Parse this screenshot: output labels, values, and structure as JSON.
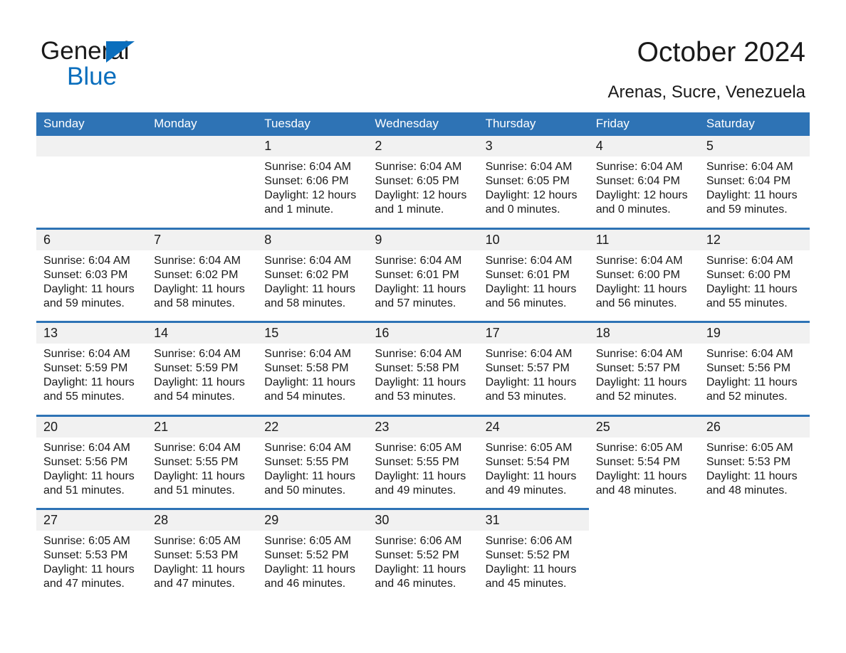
{
  "brand": {
    "name_part1": "General",
    "name_part2": "Blue",
    "accent_color": "#0a6ebd"
  },
  "header": {
    "title": "October 2024",
    "location": "Arenas, Sucre, Venezuela"
  },
  "theme": {
    "header_blue": "#2e73b5",
    "daynum_band": "#f1f1f1",
    "text": "#1a1a1a"
  },
  "calendar": {
    "weekday_headers": [
      "Sunday",
      "Monday",
      "Tuesday",
      "Wednesday",
      "Thursday",
      "Friday",
      "Saturday"
    ],
    "weeks": [
      [
        {
          "day": "",
          "lines": []
        },
        {
          "day": "",
          "lines": []
        },
        {
          "day": "1",
          "lines": [
            "Sunrise: 6:04 AM",
            "Sunset: 6:06 PM",
            "Daylight: 12 hours",
            "and 1 minute."
          ]
        },
        {
          "day": "2",
          "lines": [
            "Sunrise: 6:04 AM",
            "Sunset: 6:05 PM",
            "Daylight: 12 hours",
            "and 1 minute."
          ]
        },
        {
          "day": "3",
          "lines": [
            "Sunrise: 6:04 AM",
            "Sunset: 6:05 PM",
            "Daylight: 12 hours",
            "and 0 minutes."
          ]
        },
        {
          "day": "4",
          "lines": [
            "Sunrise: 6:04 AM",
            "Sunset: 6:04 PM",
            "Daylight: 12 hours",
            "and 0 minutes."
          ]
        },
        {
          "day": "5",
          "lines": [
            "Sunrise: 6:04 AM",
            "Sunset: 6:04 PM",
            "Daylight: 11 hours",
            "and 59 minutes."
          ]
        }
      ],
      [
        {
          "day": "6",
          "lines": [
            "Sunrise: 6:04 AM",
            "Sunset: 6:03 PM",
            "Daylight: 11 hours",
            "and 59 minutes."
          ]
        },
        {
          "day": "7",
          "lines": [
            "Sunrise: 6:04 AM",
            "Sunset: 6:02 PM",
            "Daylight: 11 hours",
            "and 58 minutes."
          ]
        },
        {
          "day": "8",
          "lines": [
            "Sunrise: 6:04 AM",
            "Sunset: 6:02 PM",
            "Daylight: 11 hours",
            "and 58 minutes."
          ]
        },
        {
          "day": "9",
          "lines": [
            "Sunrise: 6:04 AM",
            "Sunset: 6:01 PM",
            "Daylight: 11 hours",
            "and 57 minutes."
          ]
        },
        {
          "day": "10",
          "lines": [
            "Sunrise: 6:04 AM",
            "Sunset: 6:01 PM",
            "Daylight: 11 hours",
            "and 56 minutes."
          ]
        },
        {
          "day": "11",
          "lines": [
            "Sunrise: 6:04 AM",
            "Sunset: 6:00 PM",
            "Daylight: 11 hours",
            "and 56 minutes."
          ]
        },
        {
          "day": "12",
          "lines": [
            "Sunrise: 6:04 AM",
            "Sunset: 6:00 PM",
            "Daylight: 11 hours",
            "and 55 minutes."
          ]
        }
      ],
      [
        {
          "day": "13",
          "lines": [
            "Sunrise: 6:04 AM",
            "Sunset: 5:59 PM",
            "Daylight: 11 hours",
            "and 55 minutes."
          ]
        },
        {
          "day": "14",
          "lines": [
            "Sunrise: 6:04 AM",
            "Sunset: 5:59 PM",
            "Daylight: 11 hours",
            "and 54 minutes."
          ]
        },
        {
          "day": "15",
          "lines": [
            "Sunrise: 6:04 AM",
            "Sunset: 5:58 PM",
            "Daylight: 11 hours",
            "and 54 minutes."
          ]
        },
        {
          "day": "16",
          "lines": [
            "Sunrise: 6:04 AM",
            "Sunset: 5:58 PM",
            "Daylight: 11 hours",
            "and 53 minutes."
          ]
        },
        {
          "day": "17",
          "lines": [
            "Sunrise: 6:04 AM",
            "Sunset: 5:57 PM",
            "Daylight: 11 hours",
            "and 53 minutes."
          ]
        },
        {
          "day": "18",
          "lines": [
            "Sunrise: 6:04 AM",
            "Sunset: 5:57 PM",
            "Daylight: 11 hours",
            "and 52 minutes."
          ]
        },
        {
          "day": "19",
          "lines": [
            "Sunrise: 6:04 AM",
            "Sunset: 5:56 PM",
            "Daylight: 11 hours",
            "and 52 minutes."
          ]
        }
      ],
      [
        {
          "day": "20",
          "lines": [
            "Sunrise: 6:04 AM",
            "Sunset: 5:56 PM",
            "Daylight: 11 hours",
            "and 51 minutes."
          ]
        },
        {
          "day": "21",
          "lines": [
            "Sunrise: 6:04 AM",
            "Sunset: 5:55 PM",
            "Daylight: 11 hours",
            "and 51 minutes."
          ]
        },
        {
          "day": "22",
          "lines": [
            "Sunrise: 6:04 AM",
            "Sunset: 5:55 PM",
            "Daylight: 11 hours",
            "and 50 minutes."
          ]
        },
        {
          "day": "23",
          "lines": [
            "Sunrise: 6:05 AM",
            "Sunset: 5:55 PM",
            "Daylight: 11 hours",
            "and 49 minutes."
          ]
        },
        {
          "day": "24",
          "lines": [
            "Sunrise: 6:05 AM",
            "Sunset: 5:54 PM",
            "Daylight: 11 hours",
            "and 49 minutes."
          ]
        },
        {
          "day": "25",
          "lines": [
            "Sunrise: 6:05 AM",
            "Sunset: 5:54 PM",
            "Daylight: 11 hours",
            "and 48 minutes."
          ]
        },
        {
          "day": "26",
          "lines": [
            "Sunrise: 6:05 AM",
            "Sunset: 5:53 PM",
            "Daylight: 11 hours",
            "and 48 minutes."
          ]
        }
      ],
      [
        {
          "day": "27",
          "lines": [
            "Sunrise: 6:05 AM",
            "Sunset: 5:53 PM",
            "Daylight: 11 hours",
            "and 47 minutes."
          ]
        },
        {
          "day": "28",
          "lines": [
            "Sunrise: 6:05 AM",
            "Sunset: 5:53 PM",
            "Daylight: 11 hours",
            "and 47 minutes."
          ]
        },
        {
          "day": "29",
          "lines": [
            "Sunrise: 6:05 AM",
            "Sunset: 5:52 PM",
            "Daylight: 11 hours",
            "and 46 minutes."
          ]
        },
        {
          "day": "30",
          "lines": [
            "Sunrise: 6:06 AM",
            "Sunset: 5:52 PM",
            "Daylight: 11 hours",
            "and 46 minutes."
          ]
        },
        {
          "day": "31",
          "lines": [
            "Sunrise: 6:06 AM",
            "Sunset: 5:52 PM",
            "Daylight: 11 hours",
            "and 45 minutes."
          ]
        },
        {
          "day": "",
          "lines": []
        },
        {
          "day": "",
          "lines": []
        }
      ]
    ]
  }
}
